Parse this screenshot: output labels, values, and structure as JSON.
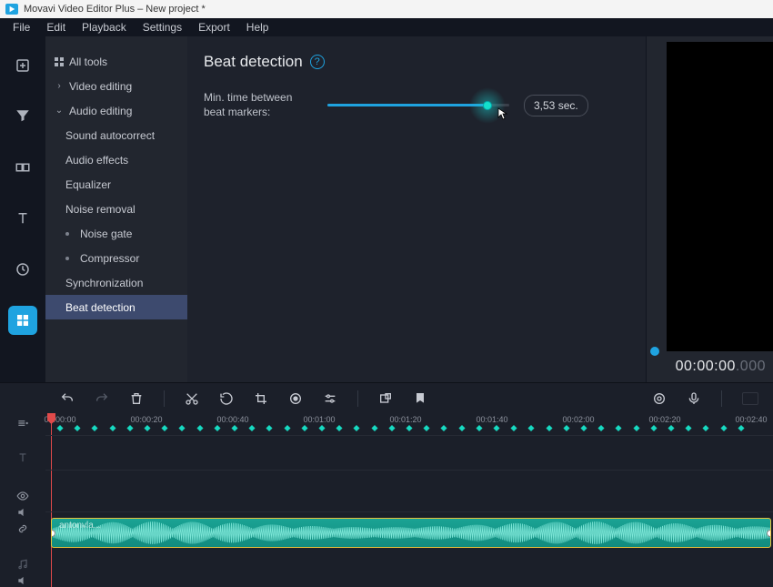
{
  "titlebar": {
    "text": "Movavi Video Editor Plus – New project *"
  },
  "menubar": [
    "File",
    "Edit",
    "Playback",
    "Settings",
    "Export",
    "Help"
  ],
  "iconstrip": [
    {
      "name": "add-media-icon"
    },
    {
      "name": "filters-icon"
    },
    {
      "name": "transitions-icon"
    },
    {
      "name": "titles-icon"
    },
    {
      "name": "stickers-icon"
    },
    {
      "name": "more-tools-icon",
      "active": true
    }
  ],
  "sidebar": {
    "all_tools": "All tools",
    "video_editing": "Video editing",
    "audio_editing": "Audio editing",
    "children": [
      "Sound autocorrect",
      "Audio effects",
      "Equalizer",
      "Noise removal",
      "Noise gate",
      "Compressor",
      "Synchronization",
      "Beat detection"
    ],
    "selected_index": 7
  },
  "panel": {
    "title": "Beat detection",
    "slider_label": "Min. time between beat markers:",
    "slider_value": "3,53 sec.",
    "slider_percent": 88
  },
  "preview": {
    "timecode": "00:00:00",
    "timecode_ms": ".000"
  },
  "toolbar": [
    "undo-icon",
    "redo-icon",
    "delete-icon",
    "sep",
    "cut-icon",
    "rotate-icon",
    "crop-icon",
    "record-icon",
    "adjust-icon",
    "sep",
    "clip-props-icon",
    "marker-icon",
    "spacer",
    "camera-icon",
    "mic-icon",
    "sep",
    "view-mode-icon"
  ],
  "timeline": {
    "labels": [
      "00:00:00",
      "00:00:20",
      "00:00:40",
      "00:01:00",
      "00:01:20",
      "00:01:40",
      "00:02:00",
      "00:02:20",
      "00:02:40"
    ],
    "clip_name": "antonvla..."
  }
}
